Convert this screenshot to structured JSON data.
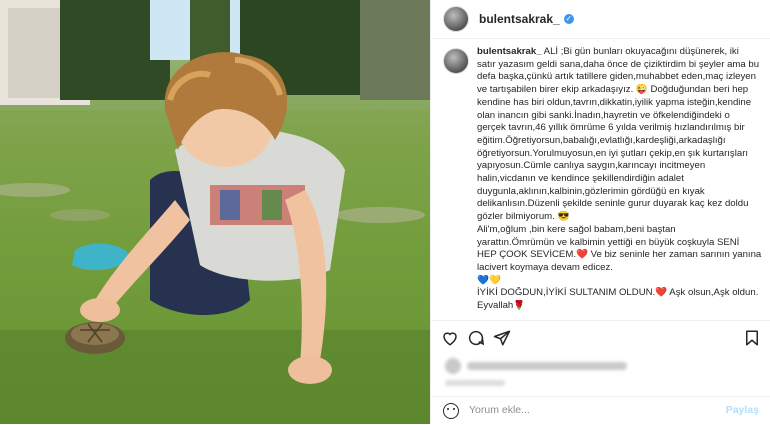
{
  "header": {
    "username": "bulentsakrak_",
    "verified": true
  },
  "caption": {
    "username": "bulentsakrak_",
    "lines": [
      "ALİ ;Bi gün bunları okuyacağını düşünerek, iki",
      "satır yazasım geldi sana,daha önce de çiziktirdim bi şeyler ama bu",
      "defa başka,çünkü artık tatillere giden,muhabbet eden,maç izleyen",
      "ve tartışabilen birer ekip arkadaşıyız. 😜 Doğduğundan beri hep",
      "kendine has biri oldun,tavrın,dikkatin,iyilik yapma isteğin,kendine",
      "olan inancın gibi sanki.İnadın,hayretin ve öfkelendiğindeki o",
      "gerçek tavrın,46 yıllık ömrüme 6 yılda verilmiş hızlandırılmış bir",
      "eğitim.Öğretiyorsun,babalığı,evlatlığı,kardeşliği,arkadaşlığı",
      "öğretiyorsun.Yorulmuyosun,en iyi şutları çekip,en şık kurtarışları",
      "yapıyosun.Cümle canlıya saygın,karıncayı incitmeyen",
      "halin,vicdanın ve kendince şekillendirdiğin adalet",
      "duygunla,aklının,kalbinin,gözlerimin gördüğü en kıyak",
      "delikanlısın.Düzenli şekilde seninle gurur duyarak kaç kez doldu",
      "gözler bilmiyorum. 😎",
      "Ali'm,oğlum ,bin kere sağol babam,beni baştan",
      "yarattın.Ömrümün ve kalbimin yettiği en büyük coşkuyla SENİ",
      "HEP ÇOOK SEVİCEM.❤️  Ve biz seninle her zaman sarının yanına",
      "lacivert koymaya devam edicez.",
      "💙💛",
      "İYİKİ DOĞDUN,İYİKİ SULTANIM OLDUN.❤️ Aşk olsun,Aşk oldun.",
      "Eyvallah🌹"
    ]
  },
  "actions": {
    "icons": [
      "heart-icon",
      "comment-icon",
      "share-icon",
      "bookmark-icon"
    ]
  },
  "comment": {
    "placeholder": "Yorum ekle...",
    "post_label": "Paylaş"
  },
  "colors": {
    "verified": "#3897f0",
    "post_disabled": "#b2dffc",
    "border": "#efefef"
  }
}
